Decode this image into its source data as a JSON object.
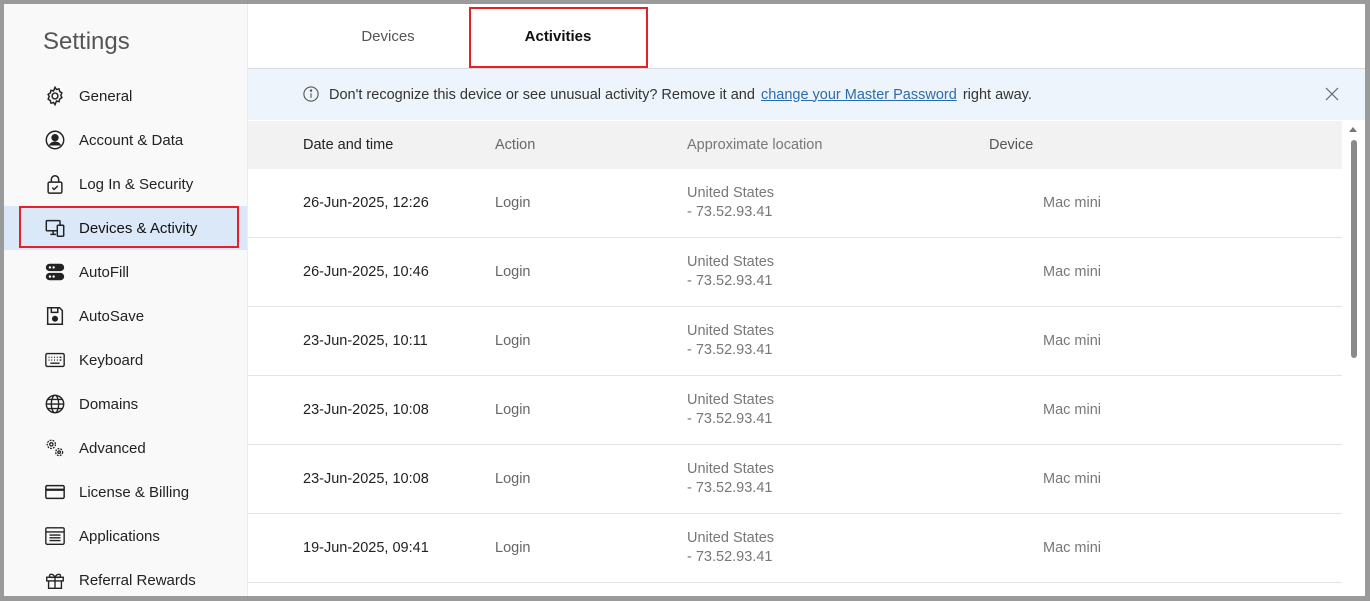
{
  "sidebar": {
    "title": "Settings",
    "items": [
      {
        "label": "General",
        "icon": "gear-icon"
      },
      {
        "label": "Account & Data",
        "icon": "user-circle-icon"
      },
      {
        "label": "Log In & Security",
        "icon": "lock-icon"
      },
      {
        "label": "Devices & Activity",
        "icon": "devices-icon",
        "active": true
      },
      {
        "label": "AutoFill",
        "icon": "autofill-icon"
      },
      {
        "label": "AutoSave",
        "icon": "save-icon"
      },
      {
        "label": "Keyboard",
        "icon": "keyboard-icon"
      },
      {
        "label": "Domains",
        "icon": "globe-icon"
      },
      {
        "label": "Advanced",
        "icon": "advanced-gears-icon"
      },
      {
        "label": "License & Billing",
        "icon": "credit-card-icon"
      },
      {
        "label": "Applications",
        "icon": "applications-icon"
      },
      {
        "label": "Referral Rewards",
        "icon": "gift-icon"
      }
    ]
  },
  "tabs": {
    "devices": "Devices",
    "activities": "Activities",
    "selected": "Activities"
  },
  "banner": {
    "text_before": "Don't recognize this device or see unusual activity? Remove it and",
    "link": "change your Master Password",
    "text_after": "right away."
  },
  "table": {
    "headers": {
      "date": "Date and time",
      "action": "Action",
      "location": "Approximate location",
      "device": "Device"
    },
    "rows": [
      {
        "date": "26-Jun-2025, 12:26",
        "action": "Login",
        "location": "United States",
        "ip": "- 73.52.93.41",
        "device": "Mac mini"
      },
      {
        "date": "26-Jun-2025, 10:46",
        "action": "Login",
        "location": "United States",
        "ip": "- 73.52.93.41",
        "device": "Mac mini"
      },
      {
        "date": "23-Jun-2025, 10:11",
        "action": "Login",
        "location": "United States",
        "ip": "- 73.52.93.41",
        "device": "Mac mini"
      },
      {
        "date": "23-Jun-2025, 10:08",
        "action": "Login",
        "location": "United States",
        "ip": "- 73.52.93.41",
        "device": "Mac mini"
      },
      {
        "date": "23-Jun-2025, 10:08",
        "action": "Login",
        "location": "United States",
        "ip": "- 73.52.93.41",
        "device": "Mac mini"
      },
      {
        "date": "19-Jun-2025, 09:41",
        "action": "Login",
        "location": "United States",
        "ip": "- 73.52.93.41",
        "device": "Mac mini"
      }
    ]
  },
  "colors": {
    "accent_highlight": "#e5202a",
    "active_bg": "#dbe8f8",
    "link": "#2b6cb0",
    "banner_bg": "#eef4fb"
  }
}
